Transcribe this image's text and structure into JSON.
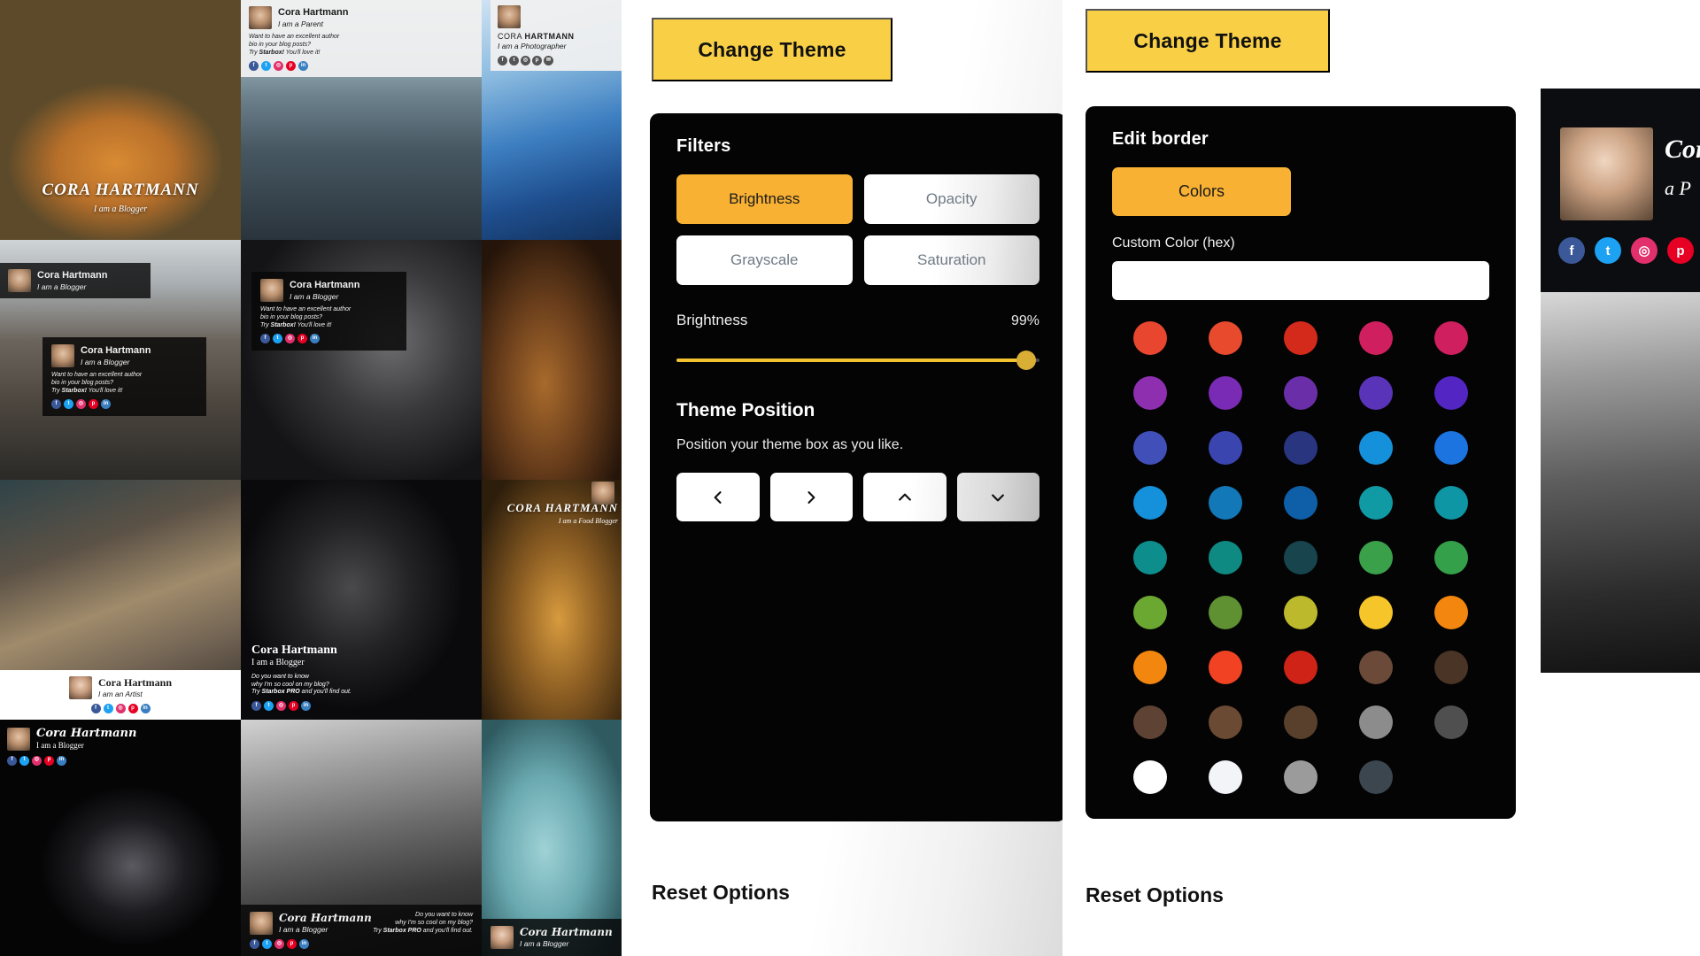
{
  "gallery": {
    "author_name": "Cora Hartmann",
    "roles": {
      "parent": "I am a Parent",
      "blogger": "I am a Blogger",
      "artist": "I am an Artist",
      "photographer": "I am a Photographer",
      "food_blogger": "I am a Food Blogger"
    },
    "bio_line1": "Want to have an excellent author",
    "bio_line2": "bio in your blog posts?",
    "bio_line3_prefix": "Try ",
    "bio_brand": "Starbox!",
    "bio_line3_suffix": " You'll love it!",
    "pro_line1": "Do you want to know",
    "pro_line2": "why I'm so cool on my blog?",
    "pro_line3_prefix": "Try ",
    "pro_brand": "Starbox PRO",
    "pro_line3_suffix": " and you'll find out.",
    "hero_name_caps": "CORA HARTMANN",
    "hero_role": "I am a Blogger",
    "name_caps_short": "CORA HARTMANN",
    "social_icons": [
      "facebook-icon",
      "twitter-icon",
      "instagram-icon",
      "pinterest-icon",
      "linkedin-icon"
    ]
  },
  "middle_panel": {
    "change_theme_label": "Change Theme",
    "card_title": "Filters",
    "filter_buttons": [
      {
        "label": "Brightness",
        "state": "active"
      },
      {
        "label": "Opacity",
        "state": "inactive"
      },
      {
        "label": "Grayscale",
        "state": "inactive"
      },
      {
        "label": "Saturation",
        "state": "inactive"
      }
    ],
    "slider": {
      "label": "Brightness",
      "value_text": "99%",
      "value": 99,
      "min": 0,
      "max": 100,
      "fill_color": "#f2c230",
      "knob_color": "#d9ae35"
    },
    "position_section": {
      "title": "Theme Position",
      "description": "Position your theme box as you like.",
      "buttons": [
        {
          "icon": "chevron-left-icon",
          "glyph": "left"
        },
        {
          "icon": "chevron-right-icon",
          "glyph": "right"
        },
        {
          "icon": "chevron-up-icon",
          "glyph": "up"
        },
        {
          "icon": "chevron-down-icon",
          "glyph": "down"
        }
      ]
    },
    "reset_label": "Reset Options"
  },
  "right_panel": {
    "change_theme_label": "Change Theme",
    "card_title": "Edit border",
    "colors_button_label": "Colors",
    "custom_color_label": "Custom Color (hex)",
    "custom_color_value": "",
    "custom_color_placeholder": "",
    "reset_label": "Reset Options",
    "swatch_rows": [
      [
        "#e8462e",
        "#e84a2e",
        "#d42a1b",
        "#cf1f5e",
        "#cf1f5e"
      ],
      [
        "#8e2fb0",
        "#7a2bb5",
        "#6a2fa8",
        "#5a34b8",
        "#5326c4"
      ],
      [
        "#4150b8",
        "#3a45b0",
        "#2a3580",
        "#1590da",
        "#1b74e0"
      ],
      [
        "#1590da",
        "#1278b8",
        "#0f5fa8",
        "#0f9aa4",
        "#0f96a4"
      ],
      [
        "#0e8d8d",
        "#0e8a82",
        "#17444d",
        "#3aa04a",
        "#34a04a"
      ],
      [
        "#6aa832",
        "#5f9133",
        "#bcb92c",
        "#f6c52a",
        "#f2860f"
      ],
      [
        "#f2860f",
        "#f14324",
        "#cf2318",
        "#6b4a3a",
        "#4a3426"
      ],
      [
        "#5e4234",
        "#6b4a33",
        "#58402c",
        "#8c8c8c",
        "#4f4f4f"
      ],
      [
        "#ffffff",
        "#f2f4f8",
        "#9b9b9b",
        "#3b464e",
        null
      ]
    ]
  },
  "edge_panel": {
    "author_name_partial": "Cora",
    "role_partial": "a P",
    "social_icons": [
      "facebook-icon",
      "twitter-icon",
      "instagram-icon",
      "pinterest-icon"
    ]
  }
}
